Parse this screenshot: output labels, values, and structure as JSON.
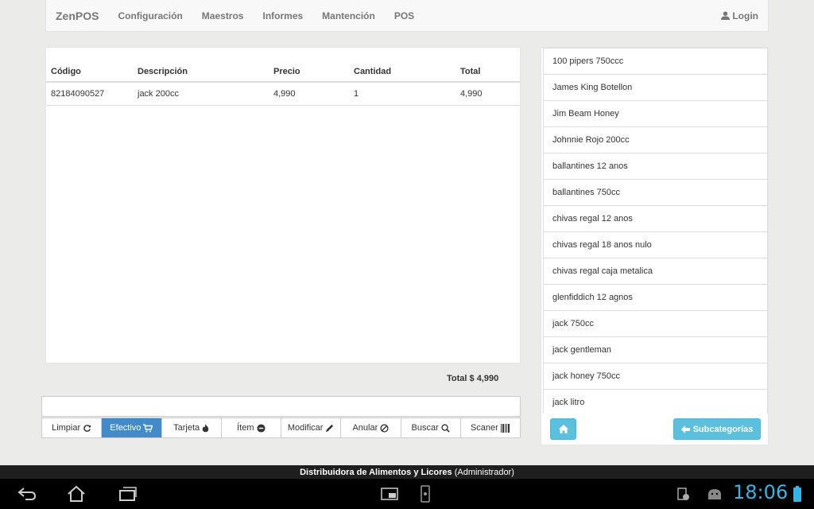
{
  "navbar": {
    "brand": "ZenPOS",
    "items": [
      "Configuración",
      "Maestros",
      "Informes",
      "Mantención",
      "POS"
    ],
    "login": "Login"
  },
  "table": {
    "headers": [
      "Código",
      "Descripción",
      "Precio",
      "Cantidad",
      "Total"
    ],
    "rows": [
      [
        "82184090527",
        "jack 200cc",
        "4,990",
        "1",
        "4,990"
      ]
    ]
  },
  "total": "Total $ 4,990",
  "actions": {
    "limpiar": "Limpiar",
    "efectivo": "Efectivo",
    "tarjeta": "Tarjeta",
    "item": "Ítem",
    "modificar": "Modificar",
    "anular": "Anular",
    "buscar": "Buscar",
    "scaner": "Scaner"
  },
  "products": [
    "100 pipers 750ccc",
    "James King Botellon",
    "Jim Beam Honey",
    "Johnnie Rojo 200cc",
    "ballantines 12 anos",
    "ballantines 750cc",
    "chivas regal 12 anos",
    "chivas regal 18 anos nulo",
    "chivas regal caja metalica",
    "glenfiddich 12 agnos",
    "jack 750cc",
    "jack gentleman",
    "jack honey 750cc",
    "jack litro"
  ],
  "subcategorias": "Subcategorías",
  "status": {
    "company": "Distribuidora de Alimentos y Licores",
    "role": "(Administrador)"
  },
  "clock": "18:06",
  "colors": {
    "primary": "#428bca",
    "info": "#5bc0de",
    "clock": "#33b5e5"
  }
}
